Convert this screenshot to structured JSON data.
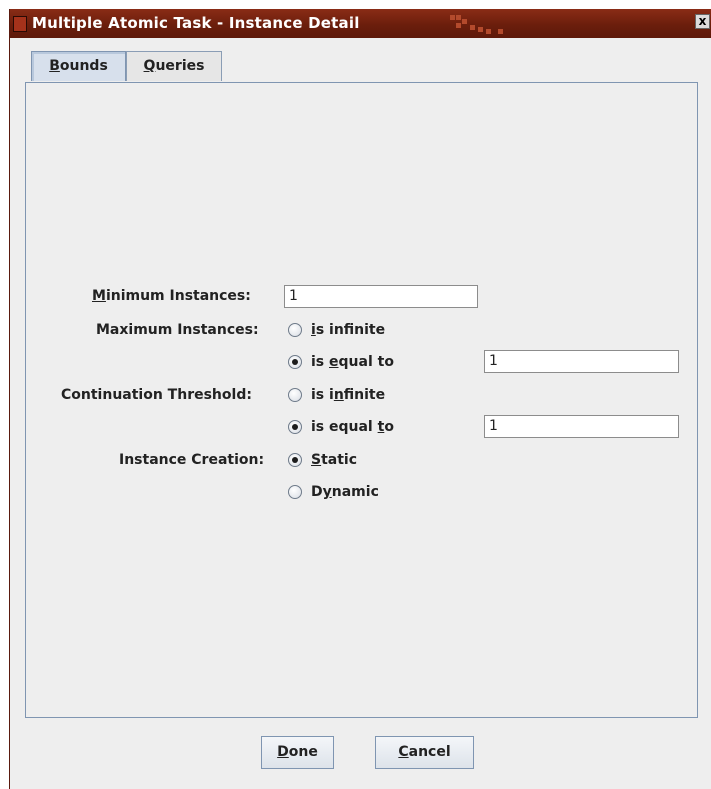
{
  "window": {
    "title": "Multiple Atomic Task - Instance Detail",
    "close_label": "x"
  },
  "tabs": [
    {
      "label": "Bounds",
      "mnemonic": "B",
      "rest": "ounds",
      "selected": true
    },
    {
      "label": "Queries",
      "mnemonic": "Q",
      "rest": "ueries",
      "selected": false
    }
  ],
  "form": {
    "minimum_instances": {
      "label_pre": "",
      "label_mn": "M",
      "label_post": "inimum Instances:",
      "value": "1"
    },
    "maximum_instances": {
      "label": "Maximum Instances:",
      "infinite": {
        "pre": "",
        "mn": "i",
        "post": "s infinite",
        "selected": false
      },
      "equal": {
        "pre": "is ",
        "mn": "e",
        "post": "qual to",
        "selected": true
      },
      "value": "1"
    },
    "continuation_threshold": {
      "label": "Continuation Threshold:",
      "infinite": {
        "pre": "is i",
        "mn": "n",
        "post": "finite",
        "selected": false
      },
      "equal": {
        "pre": "is equal ",
        "mn": "t",
        "post": "o",
        "selected": true
      },
      "value": "1"
    },
    "instance_creation": {
      "label": "Instance Creation:",
      "static": {
        "pre": "",
        "mn": "S",
        "post": "tatic",
        "selected": true
      },
      "dynamic": {
        "pre": "D",
        "mn": "y",
        "post": "namic",
        "selected": false
      }
    }
  },
  "buttons": {
    "done": {
      "pre": "",
      "mn": "D",
      "post": "one"
    },
    "cancel": {
      "pre": "",
      "mn": "C",
      "post": "ancel"
    }
  }
}
